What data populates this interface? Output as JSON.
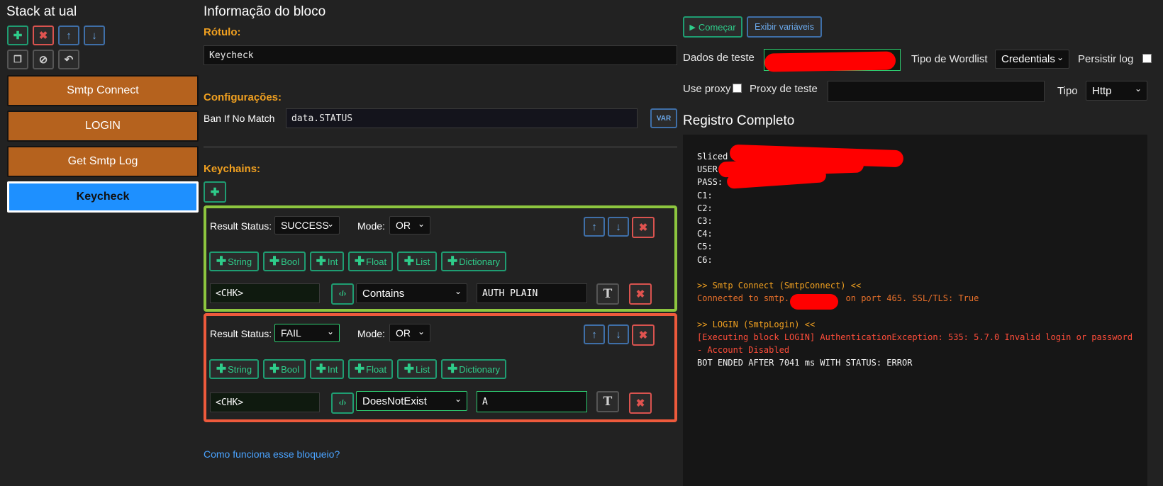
{
  "stack": {
    "title": "Stack at ual",
    "blocks": [
      "Smtp Connect",
      "LOGIN",
      "Get Smtp Log",
      "Keycheck"
    ]
  },
  "info": {
    "title": "Informação do bloco",
    "label_title": "Rótulo:",
    "label_value": "Keycheck",
    "config_title": "Configurações:",
    "ban_label": "Ban If No Match",
    "ban_value": "data.STATUS",
    "var_btn": "VAR",
    "keychains_title": "Keychains:",
    "help_link": "Como funciona esse bloqueio?"
  },
  "keychains": [
    {
      "result_label": "Result Status:",
      "status": "SUCCESS",
      "mode_label": "Mode:",
      "mode": "OR",
      "types": [
        "String",
        "Bool",
        "Int",
        "Float",
        "List",
        "Dictionary"
      ],
      "left": "<CHK>",
      "condition": "Contains",
      "right": "AUTH PLAIN"
    },
    {
      "result_label": "Result Status:",
      "status": "FAIL",
      "mode_label": "Mode:",
      "mode": "OR",
      "types": [
        "String",
        "Bool",
        "Int",
        "Float",
        "List",
        "Dictionary"
      ],
      "left": "<CHK>",
      "condition": "DoesNotExist",
      "right": "A"
    }
  ],
  "debugger": {
    "start_btn": "Começar",
    "vars_btn": "Exibir variáveis",
    "test_data_label": "Dados de teste",
    "wordlist_label": "Tipo de Wordlist",
    "wordlist_value": "Credentials",
    "persist_label": "Persistir log",
    "use_proxy_label": "Use proxy",
    "test_proxy_label": "Proxy de teste",
    "type_label": "Tipo",
    "type_value": "Http",
    "log_title": "Registro Completo",
    "log_lines": [
      {
        "text": "Sliced",
        "color": "#f5f5f5"
      },
      {
        "text": "USER:",
        "color": "#f5f5f5"
      },
      {
        "text": "PASS:",
        "color": "#f5f5f5"
      },
      {
        "text": "C1:",
        "color": "#f5f5f5"
      },
      {
        "text": "C2:",
        "color": "#f5f5f5"
      },
      {
        "text": "C3:",
        "color": "#f5f5f5"
      },
      {
        "text": "C4:",
        "color": "#f5f5f5"
      },
      {
        "text": "C5:",
        "color": "#f5f5f5"
      },
      {
        "text": "C6:",
        "color": "#f5f5f5"
      },
      {
        "text": "",
        "color": "#f5f5f5"
      },
      {
        "text": ">> Smtp Connect (SmtpConnect) <<",
        "color": "#f0a020"
      },
      {
        "text": "Connected to smtp.           on port 465. SSL/TLS: True",
        "color": "#e8702a"
      },
      {
        "text": "",
        "color": "#f5f5f5"
      },
      {
        "text": ">> LOGIN (SmtpLogin) <<",
        "color": "#f0a020"
      },
      {
        "text": "[Executing block LOGIN] AuthenticationException: 535: 5.7.0 Invalid login or password",
        "color": "#ff4d3a"
      },
      {
        "text": "- Account Disabled",
        "color": "#ff4d3a"
      },
      {
        "text": "BOT ENDED AFTER 7041 ms WITH STATUS: ERROR",
        "color": "#f5f5f5"
      }
    ]
  }
}
